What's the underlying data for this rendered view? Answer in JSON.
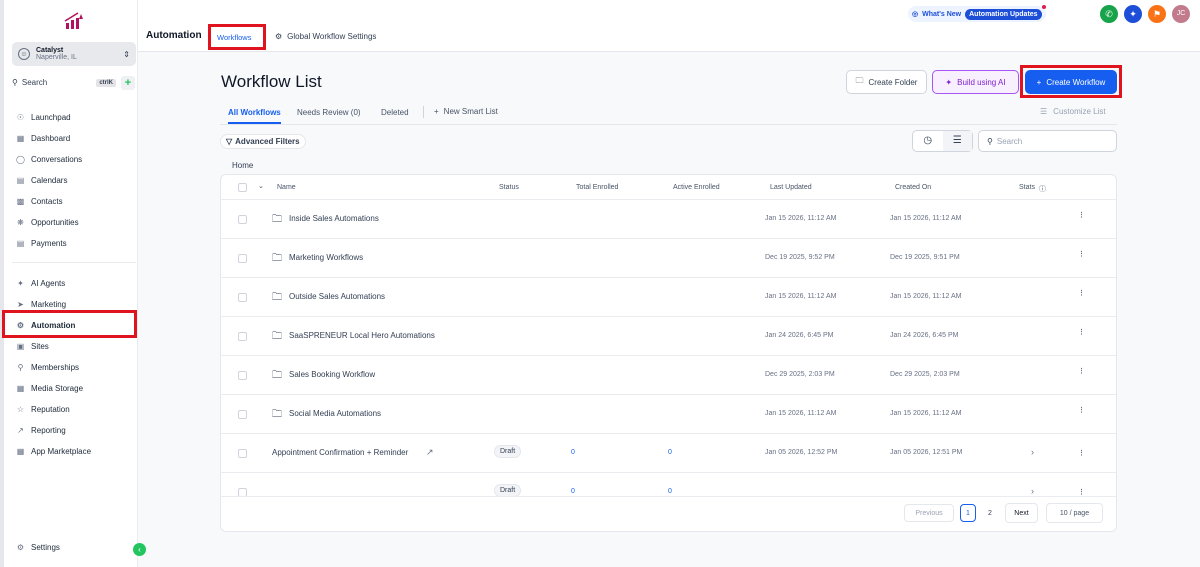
{
  "sidebar": {
    "account": {
      "name": "Catalyst",
      "location": "Naperville, IL"
    },
    "search": "Search",
    "shortcut": "ctrlK",
    "items": [
      "Launchpad",
      "Dashboard",
      "Conversations",
      "Calendars",
      "Contacts",
      "Opportunities",
      "Payments",
      "AI Agents",
      "Marketing",
      "Automation",
      "Sites",
      "Memberships",
      "Media Storage",
      "Reputation",
      "Reporting",
      "App Marketplace"
    ],
    "settings": "Settings"
  },
  "header": {
    "title": "Automation",
    "tabs": [
      "Workflows",
      "Global Workflow Settings"
    ],
    "whats_new": "What's New",
    "updates": "Automation Updates",
    "avatar": "JC"
  },
  "page": {
    "title": "Workflow List",
    "create_folder": "Create Folder",
    "build_ai": "Build using AI",
    "create_workflow": "Create Workflow",
    "customize": "Customize List",
    "tabs": [
      "All Workflows",
      "Needs Review (0)",
      "Deleted"
    ],
    "new_smart_list": "New Smart List",
    "filters": "Advanced Filters",
    "search_placeholder": "Search",
    "breadcrumb": "Home"
  },
  "table": {
    "columns": [
      "Name",
      "Status",
      "Total Enrolled",
      "Active Enrolled",
      "Last Updated",
      "Created On",
      "Stats"
    ],
    "folders": [
      {
        "name": "Inside Sales Automations",
        "updated": "Jan 15 2026, 11:12 AM",
        "created": "Jan 15 2026, 11:12 AM"
      },
      {
        "name": "Marketing Workflows",
        "updated": "Dec 19 2025, 9:52 PM",
        "created": "Dec 19 2025, 9:51 PM"
      },
      {
        "name": "Outside Sales Automations",
        "updated": "Jan 15 2026, 11:12 AM",
        "created": "Jan 15 2026, 11:12 AM"
      },
      {
        "name": "SaaSPRENEUR Local Hero Automations",
        "updated": "Jan 24 2026, 6:45 PM",
        "created": "Jan 24 2026, 6:45 PM"
      },
      {
        "name": "Sales Booking Workflow",
        "updated": "Dec 29 2025, 2:03 PM",
        "created": "Dec 29 2025, 2:03 PM"
      },
      {
        "name": "Social Media Automations",
        "updated": "Jan 15 2026, 11:12 AM",
        "created": "Jan 15 2026, 11:12 AM"
      }
    ],
    "workflows": [
      {
        "name": "Appointment Confirmation + Reminder",
        "status": "Draft",
        "total": "0",
        "active": "0",
        "updated": "Jan 05 2026, 12:52 PM",
        "created": "Jan 05 2026, 12:51 PM"
      },
      {
        "status": "Draft",
        "total": "0",
        "active": "0"
      }
    ]
  },
  "pagination": {
    "previous": "Previous",
    "pages": [
      "1",
      "2"
    ],
    "next": "Next",
    "per_page": "10 / page"
  }
}
